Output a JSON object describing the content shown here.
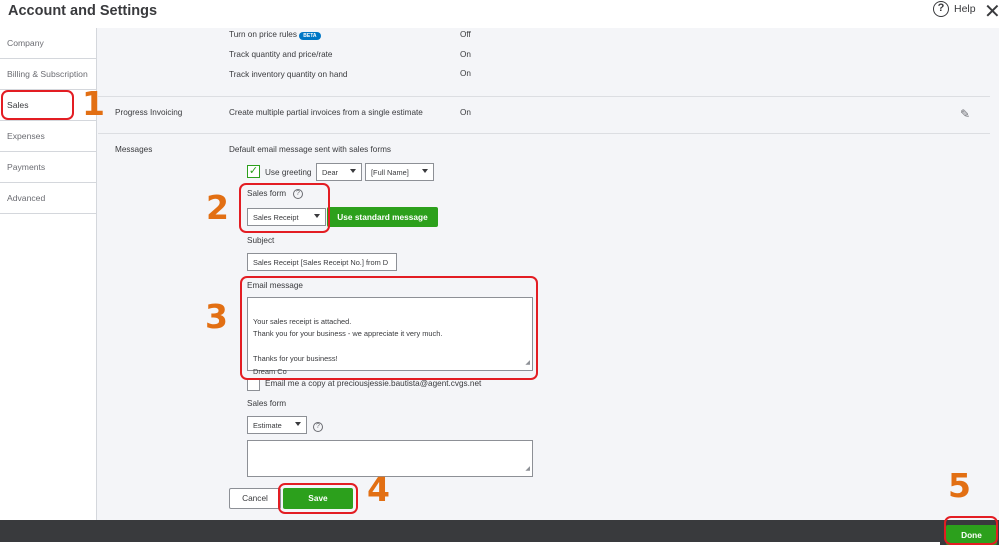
{
  "header": {
    "title": "Account and Settings",
    "help_label": "Help"
  },
  "sidebar": {
    "items": [
      {
        "label": "Company"
      },
      {
        "label": "Billing & Subscription"
      },
      {
        "label": "Sales"
      },
      {
        "label": "Expenses"
      },
      {
        "label": "Payments"
      },
      {
        "label": "Advanced"
      }
    ]
  },
  "products": {
    "rows": [
      {
        "label": "Turn on price rules",
        "badge": "BETA",
        "value": "Off"
      },
      {
        "label": "Track quantity and price/rate",
        "value": "On"
      },
      {
        "label": "Track inventory quantity on hand",
        "value": "On"
      }
    ]
  },
  "progress_invoicing": {
    "section": "Progress Invoicing",
    "label": "Create multiple partial invoices from a single estimate",
    "value": "On"
  },
  "messages": {
    "section": "Messages",
    "default_label": "Default email message sent with sales forms",
    "use_greeting_label": "Use greeting",
    "greeting_value": "Dear",
    "name_value": "[Full Name]",
    "sales_form_label": "Sales form",
    "sales_form_value": "Sales Receipt",
    "use_standard_label": "Use standard message",
    "subject_label": "Subject",
    "subject_value": "Sales Receipt [Sales Receipt No.] from D",
    "email_message_label": "Email message",
    "email_message_value": "Your sales receipt is attached.\nThank you for your business - we appreciate it very much.\n\nThanks for your business!\nDream Co",
    "email_copy_label": "Email me a copy at preciousjessie.bautista@agent.cvgs.net",
    "sales_form2_label": "Sales form",
    "sales_form2_value": "Estimate",
    "cancel_label": "Cancel",
    "save_label": "Save"
  },
  "footer": {
    "done_label": "Done"
  },
  "annotations": [
    "1",
    "2",
    "3",
    "4",
    "5"
  ],
  "colors": {
    "accent_green": "#2ca01c",
    "annotation_red": "#e31d23",
    "annotation_orange": "#e26f13",
    "footer_dark": "#393a3d"
  }
}
